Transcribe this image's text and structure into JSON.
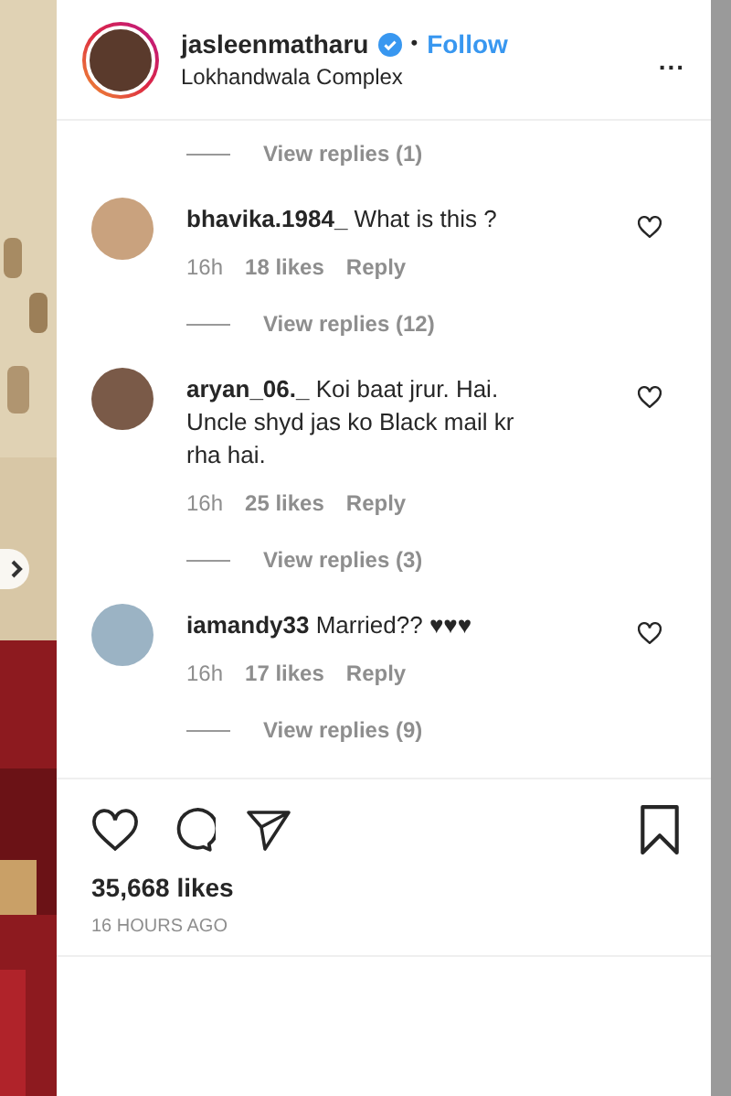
{
  "header": {
    "username": "jasleenmatharu",
    "separator": "•",
    "follow": "Follow",
    "location": "Lokhandwala Complex",
    "more": "..."
  },
  "thread": [
    {
      "kind": "replies",
      "label": "View replies (1)"
    },
    {
      "kind": "comment",
      "user": "bhavika.1984_",
      "text": "What is this ?",
      "time": "16h",
      "likes": "18 likes",
      "reply": "Reply"
    },
    {
      "kind": "replies",
      "label": "View replies (12)"
    },
    {
      "kind": "comment",
      "user": "aryan_06._",
      "text": "Koi baat jrur. Hai. Uncle shyd jas ko Black mail kr rha hai.",
      "time": "16h",
      "likes": "25 likes",
      "reply": "Reply"
    },
    {
      "kind": "replies",
      "label": "View replies (3)"
    },
    {
      "kind": "comment",
      "user": "iamandy33",
      "text": "Married?? ♥♥♥",
      "time": "16h",
      "likes": "17 likes",
      "reply": "Reply"
    },
    {
      "kind": "replies",
      "label": "View replies (9)"
    }
  ],
  "likes": "35,668 likes",
  "posted": "16 HOURS AGO"
}
